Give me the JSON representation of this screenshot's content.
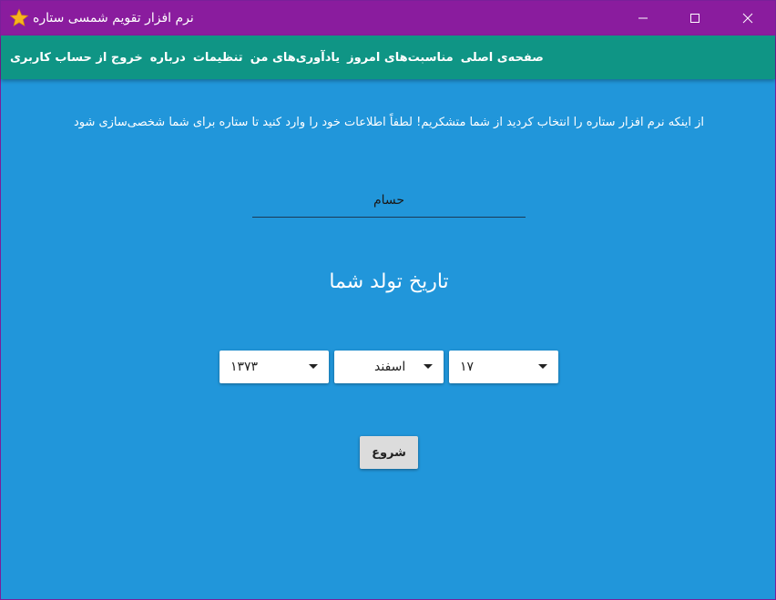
{
  "window": {
    "title": "نرم افزار تقویم شمسی ستاره",
    "icon": "star-icon"
  },
  "colors": {
    "titlebar": "#8a1c9e",
    "navbar": "#0f9585",
    "background": "#2196da",
    "button": "#dcdcdc"
  },
  "nav": {
    "items": [
      {
        "label": "صفحه‌ی اصلی"
      },
      {
        "label": "مناسبت‌های امروز"
      },
      {
        "label": "یادآوری‌های من"
      },
      {
        "label": "تنظیمات"
      },
      {
        "label": "درباره"
      },
      {
        "label": "خروج از حساب کاربری"
      }
    ]
  },
  "main": {
    "intro": "از اینکه نرم افزار ستاره را انتخاب کردید از شما متشکریم! لطفاً اطلاعات خود را وارد کنید تا ستاره برای شما شخصی‌سازی شود",
    "name_value": "حسام",
    "dob_title": "تاریخ تولد شما",
    "day": "۱۷",
    "month": "اسفند",
    "year": "۱۳۷۳",
    "start_label": "شروع"
  }
}
